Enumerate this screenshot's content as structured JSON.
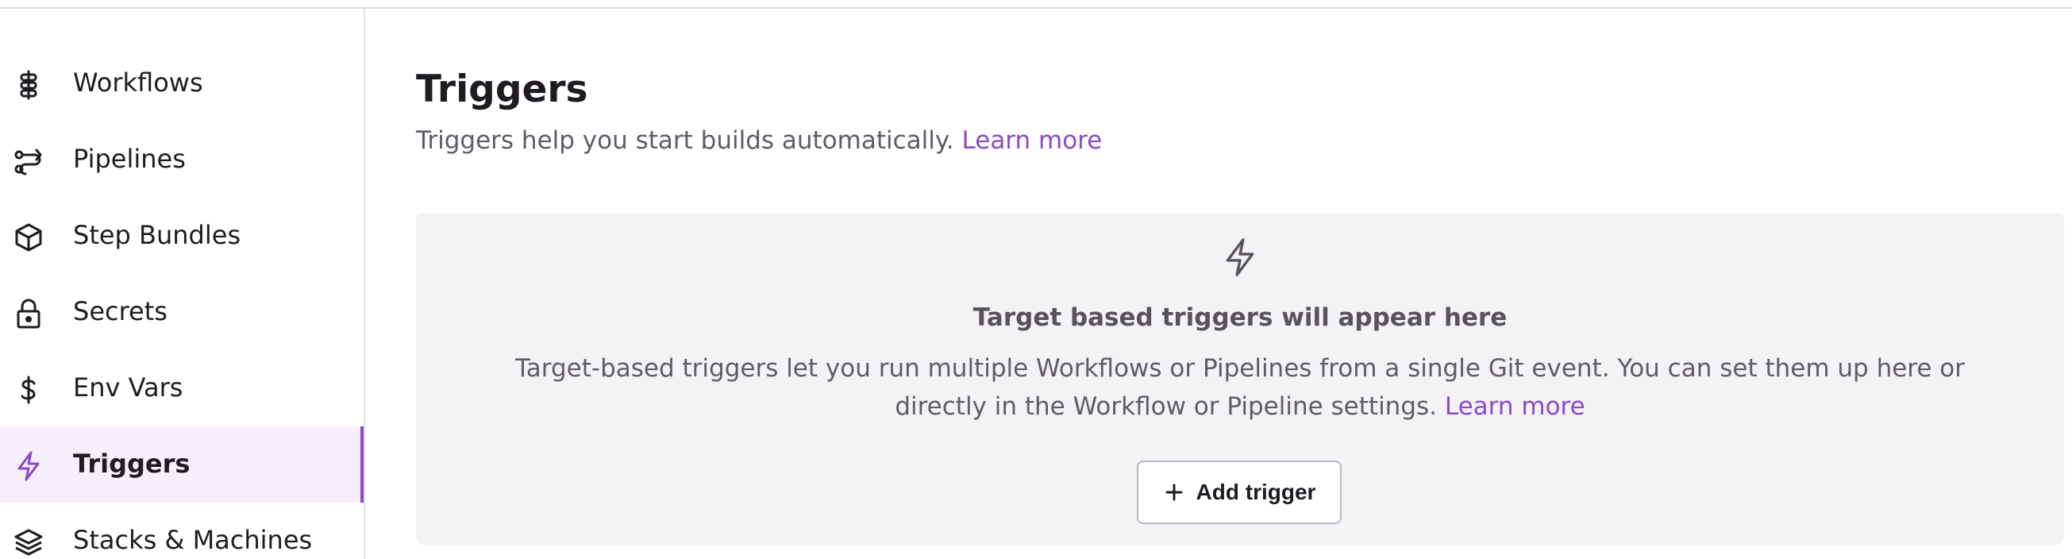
{
  "sidebar": {
    "items": [
      {
        "label": "Workflows",
        "icon": "workflows-icon"
      },
      {
        "label": "Pipelines",
        "icon": "pipelines-icon"
      },
      {
        "label": "Step Bundles",
        "icon": "box-icon"
      },
      {
        "label": "Secrets",
        "icon": "lock-icon"
      },
      {
        "label": "Env Vars",
        "icon": "dollar-icon"
      },
      {
        "label": "Triggers",
        "icon": "bolt-icon",
        "active": true
      },
      {
        "label": "Stacks & Machines",
        "icon": "layers-icon"
      }
    ]
  },
  "main": {
    "title": "Triggers",
    "subtitle": "Triggers help you start builds automatically.",
    "subtitle_link": "Learn more",
    "empty_state": {
      "icon": "bolt-icon",
      "title": "Target based triggers will appear here",
      "description": "Target-based triggers let you run multiple Workflows or Pipelines from a single Git event. You can set them up here or directly in the Workflow or Pipeline settings.",
      "link": "Learn more",
      "button_label": "Add trigger"
    }
  },
  "colors": {
    "accent": "#8a4bc4",
    "active_bg": "#f5eefb",
    "panel_bg": "#f4f2f5",
    "text": "#201b22",
    "muted_text": "#605b66"
  }
}
